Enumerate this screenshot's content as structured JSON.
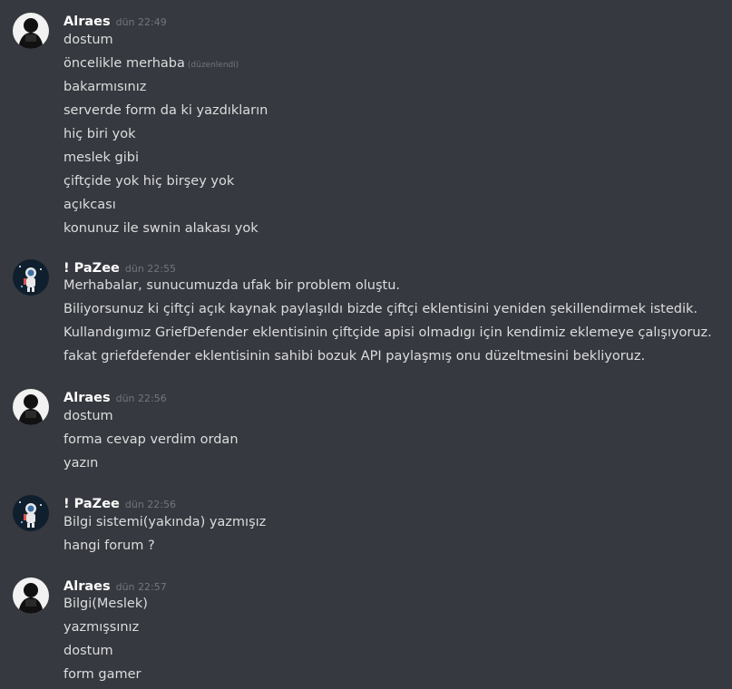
{
  "colors": {
    "background": "#36393f",
    "username": "#ffffff",
    "timestamp": "#72767d",
    "text": "#dcddde"
  },
  "messages": [
    {
      "author": "Alraes",
      "avatar": "alraes-avatar-icon",
      "time": "dün 22:49",
      "lines": [
        "dostum",
        "öncelikle merhaba",
        "bakarmısınız",
        "serverde form da ki yazdıkların",
        "hiç biri yok",
        "meslek gibi",
        "çiftçide yok hiç birşey yok",
        "açıkcası",
        "konunuz ile swnin alakası yok"
      ],
      "edited_label": "(düzenlendi)"
    },
    {
      "author": "! PaZee",
      "avatar": "astronaut-avatar-icon",
      "time": "dün 22:55",
      "lines": [
        "Merhabalar, sunucumuzda ufak bir problem oluştu.",
        "Biliyorsunuz ki çiftçi açık kaynak paylaşıldı bizde çiftçi eklentisini yeniden şekillendirmek istedik.",
        "Kullandıgımız GriefDefender eklentisinin çiftçide apisi olmadıgı için kendimiz eklemeye çalışıyoruz.",
        "fakat griefdefender eklentisinin sahibi bozuk API paylaşmış onu düzeltmesini bekliyoruz."
      ]
    },
    {
      "author": "Alraes",
      "avatar": "alraes-avatar-icon",
      "time": "dün 22:56",
      "lines": [
        "dostum",
        "forma cevap verdim ordan",
        "yazın"
      ]
    },
    {
      "author": "! PaZee",
      "avatar": "astronaut-avatar-icon",
      "time": "dün 22:56",
      "lines": [
        "Bilgi sistemi(yakında) yazmışız",
        "hangi forum ?"
      ]
    },
    {
      "author": "Alraes",
      "avatar": "alraes-avatar-icon",
      "time": "dün 22:57",
      "lines": [
        "Bilgi(Meslek)",
        "yazmışsınız",
        "dostum",
        "form gamer"
      ]
    }
  ]
}
